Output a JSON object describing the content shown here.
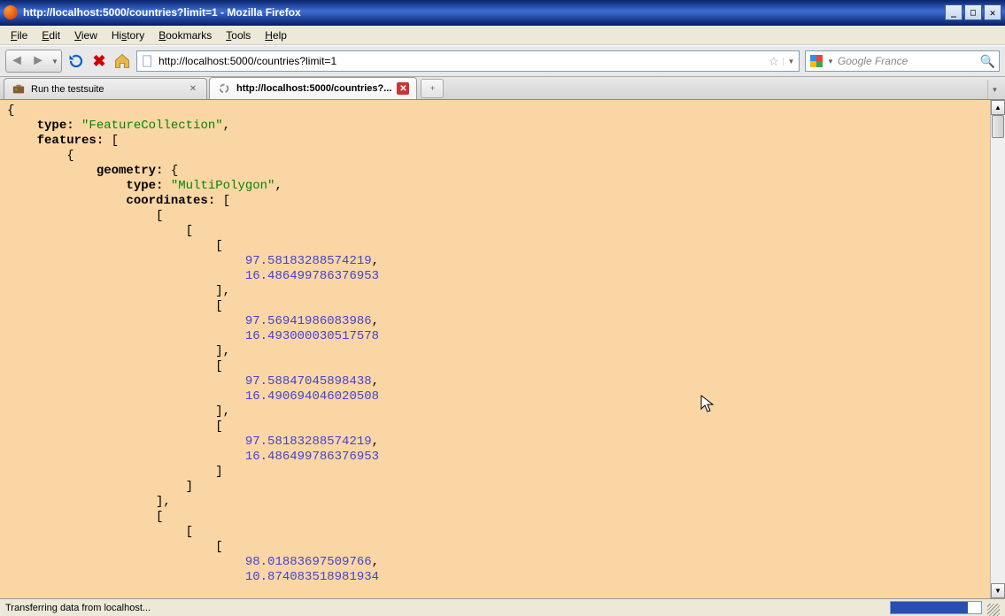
{
  "window": {
    "title": "http://localhost:5000/countries?limit=1 - Mozilla Firefox"
  },
  "menu": {
    "file": "File",
    "edit": "Edit",
    "view": "View",
    "history": "History",
    "bookmarks": "Bookmarks",
    "tools": "Tools",
    "help": "Help"
  },
  "toolbar": {
    "url": "http://localhost:5000/countries?limit=1",
    "search_placeholder": "Google France"
  },
  "tabs": {
    "items": [
      {
        "label": "Run the testsuite",
        "active": false
      },
      {
        "label": "http://localhost:5000/countries?...",
        "active": true
      }
    ]
  },
  "json_body": {
    "type_key": "type:",
    "type_val": "\"FeatureCollection\"",
    "features_key": "features:",
    "geometry_key": "geometry:",
    "geo_type_val": "\"MultiPolygon\"",
    "coords_key": "coordinates:",
    "vals": {
      "v0": "97.58183288574219",
      "v1": "16.486499786376953",
      "v2": "97.56941986083986",
      "v3": "16.493000030517578",
      "v4": "97.58847045898438",
      "v5": "16.490694046020508",
      "v6": "97.58183288574219",
      "v7": "16.486499786376953",
      "v8": "98.01883697509766",
      "v9": "10.874083518981934"
    }
  },
  "status": {
    "text": "Transferring data from localhost..."
  }
}
